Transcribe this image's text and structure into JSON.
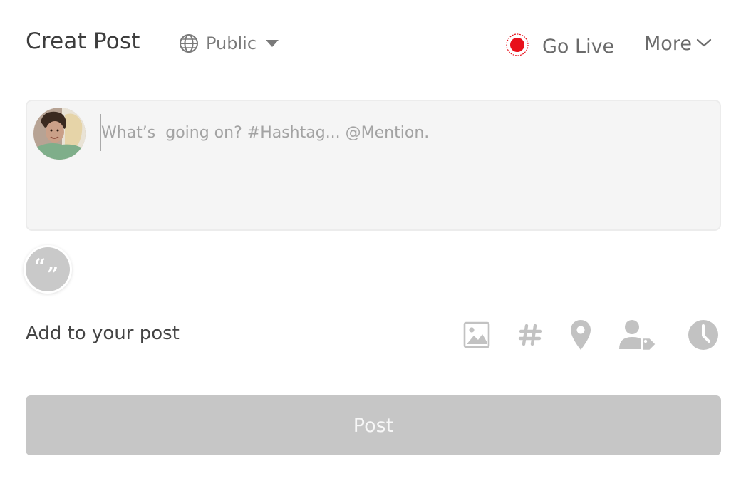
{
  "header": {
    "title": "Creat Post",
    "privacy": {
      "label": "Public",
      "icon": "globe-icon"
    },
    "go_live": {
      "label": "Go Live",
      "icon": "record-icon",
      "color": "#e8101a"
    },
    "more": {
      "label": "More",
      "icon": "chevron-down-icon"
    }
  },
  "composer": {
    "placeholder": "What’s  going on? #Hashtag... @Mention.",
    "value": "",
    "avatar": "user-avatar"
  },
  "quote": {
    "icon": "quote-icon"
  },
  "add_to_post": {
    "label": "Add to your post",
    "tools": [
      {
        "icon": "image-icon"
      },
      {
        "icon": "hashtag-icon"
      },
      {
        "icon": "location-pin-icon"
      },
      {
        "icon": "tag-person-icon"
      },
      {
        "icon": "clock-icon"
      }
    ]
  },
  "post_button": {
    "label": "Post",
    "background": "#c6c6c6"
  }
}
